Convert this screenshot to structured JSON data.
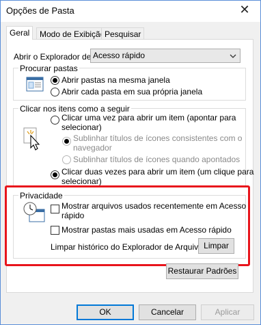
{
  "window": {
    "title": "Opções de Pasta",
    "close_glyph": "✕"
  },
  "tabs": [
    {
      "label": "Geral"
    },
    {
      "label": "Modo de Exibição"
    },
    {
      "label": "Pesquisar"
    }
  ],
  "open_explorer": {
    "label": "Abrir o Explorador de A",
    "value": "Acesso rápido"
  },
  "browse_folders": {
    "legend": "Procurar pastas",
    "options": [
      {
        "label": "Abrir pastas na mesma janela",
        "selected": true
      },
      {
        "label": "Abrir cada pasta em sua própria janela",
        "selected": false
      }
    ]
  },
  "click_items": {
    "legend": "Clicar nos itens como a seguir",
    "single_click": {
      "label_line1": "Clicar uma vez para abrir um item (apontar para",
      "label_line2": "selecionar)",
      "selected": false
    },
    "underline_browser": {
      "label_line1": "Sublinhar títulos de ícones consistentes com o",
      "label_line2": "navegador",
      "selected": true
    },
    "underline_hover": {
      "label": "Sublinhar títulos de ícones quando apontados",
      "selected": false
    },
    "double_click": {
      "label_line1": "Clicar duas vezes para abrir um item (um clique para",
      "label_line2": "selecionar)",
      "selected": true
    }
  },
  "privacy": {
    "legend": "Privacidade",
    "show_recent_files": {
      "label_line1": "Mostrar arquivos usados recentemente em Acesso",
      "label_line2": "rápido",
      "checked": false
    },
    "show_frequent_folders": {
      "label": "Mostrar pastas mais usadas em Acesso rápido",
      "checked": false
    },
    "clear_history_label": "Limpar histórico do Explorador de Arquivos",
    "clear_button": "Limpar",
    "highlight_color": "#e8141b"
  },
  "restore_button": "Restaurar Padrões",
  "footer": {
    "ok": "OK",
    "cancel": "Cancelar",
    "apply": "Aplicar"
  },
  "colors": {
    "accent": "#0078d7",
    "window_border": "#5a8ed8"
  }
}
